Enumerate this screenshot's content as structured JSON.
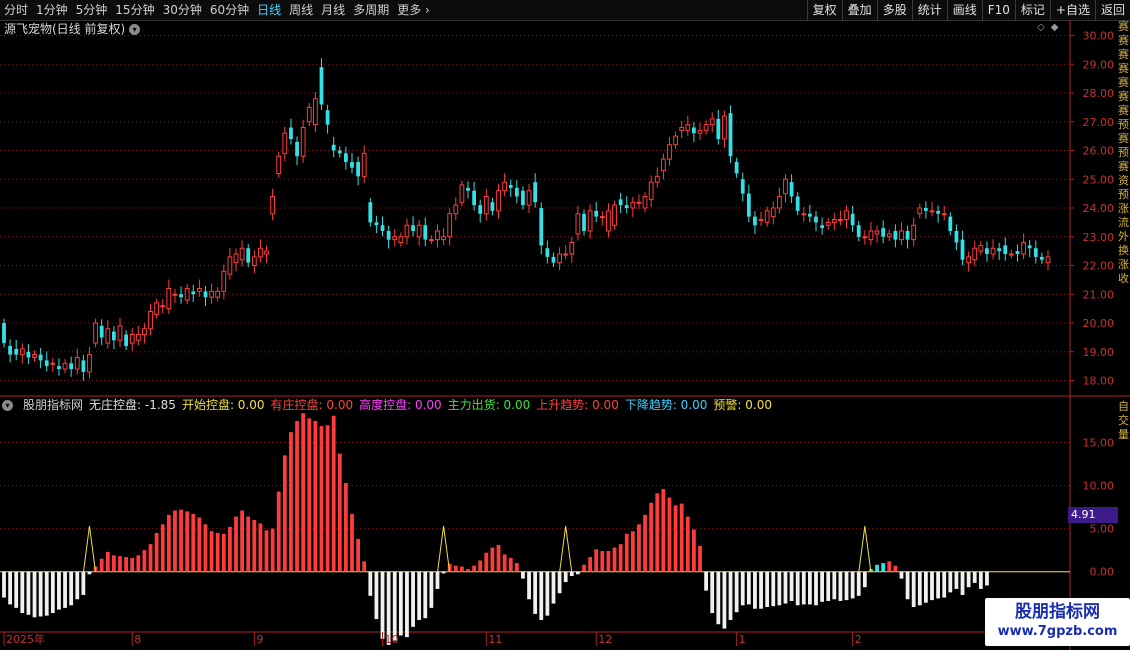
{
  "topbar": {
    "tabs": [
      {
        "label": "分时",
        "active": false
      },
      {
        "label": "1分钟",
        "active": false
      },
      {
        "label": "5分钟",
        "active": false
      },
      {
        "label": "15分钟",
        "active": false
      },
      {
        "label": "30分钟",
        "active": false
      },
      {
        "label": "60分钟",
        "active": false
      },
      {
        "label": "日线",
        "active": true
      },
      {
        "label": "周线",
        "active": false
      },
      {
        "label": "月线",
        "active": false
      },
      {
        "label": "多周期",
        "active": false
      },
      {
        "label": "更多",
        "active": false
      }
    ],
    "actions": [
      "复权",
      "叠加",
      "多股",
      "统计",
      "画线",
      "F10",
      "标记",
      "+自选",
      "返回"
    ]
  },
  "chart_title": "源飞宠物(日线 前复权)",
  "indicator_legend": [
    {
      "label": "股朋指标网",
      "color": "#d0d0d0"
    },
    {
      "label": "无庄控盘: -1.85",
      "color": "#e0e0e0"
    },
    {
      "label": "开始控盘: 0.00",
      "color": "#f0e040"
    },
    {
      "label": "有庄控盘: 0.00",
      "color": "#ff4040"
    },
    {
      "label": "高度控盘: 0.00",
      "color": "#ff40ff"
    },
    {
      "label": "主力出货: 0.00",
      "color": "#40e040"
    },
    {
      "label": "上升趋势: 0.00",
      "color": "#ff4040"
    },
    {
      "label": "下降趋势: 0.00",
      "color": "#40d0ff"
    },
    {
      "label": "预警: 0.00",
      "color": "#f0e040"
    }
  ],
  "current_value_label": "4.91",
  "right_strip_text": "赛赛赛赛赛赛赛预赛预赛资预涨流外换涨收",
  "right_strip_text2": "自交量",
  "watermark": {
    "line1": "股朋指标网",
    "line2": "www.7gpzb.com"
  },
  "colors": {
    "up": "#ff3c3c",
    "down": "#33e0e6",
    "grid": "#7a1a1a",
    "axis": "#b02020",
    "white_bar": "#f0f0f0",
    "yellow": "#f0e040"
  },
  "chart_data": [
    {
      "type": "candlestick",
      "ylim": [
        17.6,
        30.4
      ],
      "y_ticks": [
        "18.00",
        "19.00",
        "20.00",
        "21.00",
        "22.00",
        "23.00",
        "24.00",
        "25.00",
        "26.00",
        "27.00",
        "28.00",
        "29.00",
        "30.00"
      ],
      "y_tick_values": [
        18,
        19,
        20,
        21,
        22,
        23,
        24,
        25,
        26,
        27,
        28,
        29,
        30
      ],
      "candles": [
        [
          20.0,
          19.3
        ],
        [
          19.2,
          18.9
        ],
        [
          19.1,
          18.9
        ],
        [
          18.9,
          19.1
        ],
        [
          19.0,
          18.8
        ],
        [
          18.8,
          18.9
        ],
        [
          18.9,
          18.7
        ],
        [
          18.7,
          18.5
        ],
        [
          18.6,
          18.6
        ],
        [
          18.5,
          18.4
        ],
        [
          18.4,
          18.6
        ],
        [
          18.6,
          18.4
        ],
        [
          18.4,
          18.8
        ],
        [
          18.7,
          18.3
        ],
        [
          18.3,
          18.9
        ],
        [
          19.3,
          20.0
        ],
        [
          19.9,
          19.5
        ],
        [
          19.3,
          19.8
        ],
        [
          19.7,
          19.4
        ],
        [
          19.4,
          19.9
        ],
        [
          19.6,
          19.2
        ],
        [
          19.3,
          19.6
        ],
        [
          19.4,
          19.6
        ],
        [
          19.6,
          19.8
        ],
        [
          19.8,
          20.4
        ],
        [
          20.3,
          20.7
        ],
        [
          20.6,
          20.6
        ],
        [
          20.5,
          21.2
        ],
        [
          21.0,
          21.0
        ],
        [
          21.0,
          20.9
        ],
        [
          20.8,
          21.2
        ],
        [
          21.1,
          21.0
        ],
        [
          21.1,
          21.2
        ],
        [
          21.1,
          20.9
        ],
        [
          20.9,
          21.1
        ],
        [
          20.9,
          21.1
        ],
        [
          21.1,
          21.8
        ],
        [
          21.7,
          22.3
        ],
        [
          22.1,
          22.4
        ],
        [
          22.2,
          22.6
        ],
        [
          22.6,
          22.1
        ],
        [
          22.0,
          22.3
        ],
        [
          22.3,
          22.6
        ],
        [
          22.4,
          22.5
        ],
        [
          23.8,
          24.4
        ],
        [
          25.2,
          25.8
        ],
        [
          25.9,
          26.6
        ],
        [
          26.8,
          26.4
        ],
        [
          26.3,
          25.8
        ],
        [
          25.8,
          26.8
        ],
        [
          27.0,
          27.5
        ],
        [
          26.9,
          27.8
        ],
        [
          28.9,
          27.6
        ],
        [
          27.4,
          26.9
        ],
        [
          26.2,
          26.0
        ],
        [
          26.0,
          25.9
        ],
        [
          25.9,
          25.6
        ],
        [
          25.6,
          25.4
        ],
        [
          25.6,
          25.1
        ],
        [
          25.1,
          25.9
        ],
        [
          24.2,
          23.5
        ],
        [
          23.5,
          23.4
        ],
        [
          23.4,
          23.2
        ],
        [
          23.2,
          22.9
        ],
        [
          22.9,
          23.0
        ],
        [
          22.8,
          23.0
        ],
        [
          23.0,
          23.4
        ],
        [
          23.4,
          23.2
        ],
        [
          23.0,
          23.4
        ],
        [
          23.4,
          22.9
        ],
        [
          22.9,
          22.9
        ],
        [
          22.9,
          23.2
        ],
        [
          22.9,
          23.0
        ],
        [
          23.0,
          23.8
        ],
        [
          23.8,
          24.1
        ],
        [
          24.2,
          24.8
        ],
        [
          24.7,
          24.6
        ],
        [
          24.6,
          24.1
        ],
        [
          24.1,
          23.8
        ],
        [
          23.8,
          24.4
        ],
        [
          24.2,
          23.9
        ],
        [
          23.9,
          24.6
        ],
        [
          24.6,
          24.9
        ],
        [
          24.8,
          24.7
        ],
        [
          24.7,
          24.4
        ],
        [
          24.6,
          24.1
        ],
        [
          24.1,
          24.6
        ],
        [
          24.9,
          24.2
        ],
        [
          24.0,
          22.7
        ],
        [
          22.6,
          22.3
        ],
        [
          22.3,
          22.1
        ],
        [
          22.1,
          22.4
        ],
        [
          22.4,
          22.4
        ],
        [
          22.4,
          22.8
        ],
        [
          23.1,
          23.8
        ],
        [
          23.8,
          23.2
        ],
        [
          23.2,
          23.9
        ],
        [
          23.9,
          23.7
        ],
        [
          23.7,
          23.7
        ],
        [
          23.2,
          23.9
        ],
        [
          23.4,
          24.1
        ],
        [
          24.3,
          24.1
        ],
        [
          24.1,
          24.0
        ],
        [
          24.0,
          24.2
        ],
        [
          24.2,
          24.2
        ],
        [
          24.0,
          24.4
        ],
        [
          24.3,
          24.9
        ],
        [
          24.9,
          25.1
        ],
        [
          25.3,
          25.7
        ],
        [
          25.7,
          26.2
        ],
        [
          26.2,
          26.5
        ],
        [
          26.7,
          26.8
        ],
        [
          26.7,
          26.9
        ],
        [
          26.8,
          26.6
        ],
        [
          26.6,
          26.7
        ],
        [
          26.7,
          26.9
        ],
        [
          26.9,
          27.1
        ],
        [
          27.1,
          26.4
        ],
        [
          26.4,
          27.2
        ],
        [
          27.3,
          25.8
        ],
        [
          25.6,
          25.2
        ],
        [
          25.0,
          24.5
        ],
        [
          24.5,
          23.7
        ],
        [
          23.7,
          23.4
        ],
        [
          23.6,
          23.6
        ],
        [
          23.5,
          23.9
        ],
        [
          23.7,
          24.0
        ],
        [
          24.0,
          24.4
        ],
        [
          24.5,
          25.0
        ],
        [
          24.9,
          24.4
        ],
        [
          24.4,
          23.9
        ],
        [
          23.8,
          23.8
        ],
        [
          23.8,
          23.7
        ],
        [
          23.7,
          23.5
        ],
        [
          23.4,
          23.3
        ],
        [
          23.4,
          23.5
        ],
        [
          23.5,
          23.6
        ],
        [
          23.6,
          23.6
        ],
        [
          23.6,
          23.9
        ],
        [
          23.8,
          23.4
        ],
        [
          23.4,
          23.0
        ],
        [
          23.0,
          23.0
        ],
        [
          22.9,
          23.2
        ],
        [
          23.1,
          23.2
        ],
        [
          23.3,
          23.0
        ],
        [
          23.0,
          23.1
        ],
        [
          23.2,
          22.9
        ],
        [
          22.9,
          23.2
        ],
        [
          23.2,
          22.9
        ],
        [
          22.9,
          23.4
        ],
        [
          23.8,
          24.0
        ],
        [
          24.0,
          23.9
        ],
        [
          23.9,
          23.9
        ],
        [
          23.9,
          23.8
        ],
        [
          23.8,
          23.8
        ],
        [
          23.7,
          23.2
        ],
        [
          23.2,
          22.8
        ],
        [
          22.9,
          22.2
        ],
        [
          22.1,
          22.3
        ],
        [
          22.2,
          22.6
        ],
        [
          22.5,
          22.7
        ],
        [
          22.6,
          22.4
        ],
        [
          22.4,
          22.6
        ],
        [
          22.6,
          22.5
        ],
        [
          22.7,
          22.4
        ],
        [
          22.4,
          22.4
        ],
        [
          22.5,
          22.4
        ],
        [
          22.4,
          22.8
        ],
        [
          22.7,
          22.6
        ],
        [
          22.6,
          22.3
        ],
        [
          22.3,
          22.2
        ],
        [
          22.1,
          22.3
        ]
      ]
    },
    {
      "type": "bar",
      "ylim": [
        -7,
        19
      ],
      "y_ticks": [
        "0.00",
        "5.00",
        "10.00",
        "15.00"
      ],
      "y_tick_values": [
        0,
        5,
        10,
        15
      ],
      "values": [
        -3.0,
        -3.8,
        -4.2,
        -4.8,
        -5.0,
        -5.3,
        -5.2,
        -5.1,
        -4.8,
        -4.4,
        -4.2,
        -3.9,
        -3.2,
        -2.7,
        -0.3,
        0.6,
        1.5,
        2.3,
        1.9,
        1.8,
        1.7,
        1.6,
        1.9,
        2.5,
        3.2,
        4.5,
        5.5,
        6.6,
        7.1,
        7.2,
        7.0,
        6.7,
        6.3,
        5.5,
        4.7,
        4.5,
        4.4,
        5.2,
        6.4,
        7.1,
        6.4,
        6.0,
        5.6,
        4.8,
        5.0,
        9.3,
        13.5,
        16.2,
        17.5,
        18.4,
        17.8,
        17.5,
        16.9,
        17.0,
        18.1,
        13.7,
        10.3,
        6.7,
        3.8,
        1.2,
        -2.8,
        -5.5,
        -7.8,
        -8.5,
        -8.0,
        -7.4,
        -7.6,
        -6.4,
        -5.6,
        -5.4,
        -4.2,
        -2.0,
        -0.2,
        0.9,
        0.7,
        0.6,
        0.3,
        0.7,
        1.3,
        2.2,
        2.8,
        3.1,
        2.0,
        1.6,
        1.0,
        -0.8,
        -3.2,
        -4.9,
        -5.6,
        -5.1,
        -3.7,
        -2.5,
        -1.2,
        -0.5,
        -0.3,
        0.8,
        1.7,
        2.6,
        2.4,
        2.4,
        2.8,
        3.2,
        4.4,
        4.7,
        5.5,
        6.6,
        8.0,
        9.1,
        9.6,
        8.6,
        7.7,
        7.9,
        6.4,
        4.9,
        3.0,
        -2.2,
        -4.8,
        -6.1,
        -6.6,
        -5.6,
        -4.7,
        -3.9,
        -3.8,
        -4.3,
        -4.3,
        -4.1,
        -4.0,
        -3.9,
        -3.7,
        -3.4,
        -3.9,
        -3.8,
        -3.8,
        -3.9,
        -3.5,
        -3.4,
        -3.2,
        -3.4,
        -3.3,
        -3.1,
        -2.8,
        -1.8,
        0.3,
        0.8,
        1.0,
        1.2,
        0.7,
        -0.8,
        -3.2,
        -4.1,
        -3.9,
        -3.6,
        -3.3,
        -3.1,
        -3.0,
        -2.4,
        -2.0,
        -2.7,
        -1.8,
        -1.3,
        -2.0,
        -1.6
      ],
      "warning_peaks": [
        14,
        72,
        92,
        141
      ]
    }
  ],
  "x_axis": {
    "labels": [
      {
        "text": "2025年",
        "index": 0
      },
      {
        "text": "8",
        "index": 21
      },
      {
        "text": "9",
        "index": 41
      },
      {
        "text": "10",
        "index": 62
      },
      {
        "text": "11",
        "index": 79
      },
      {
        "text": "12",
        "index": 97
      },
      {
        "text": "1",
        "index": 120
      },
      {
        "text": "2",
        "index": 139
      }
    ]
  }
}
